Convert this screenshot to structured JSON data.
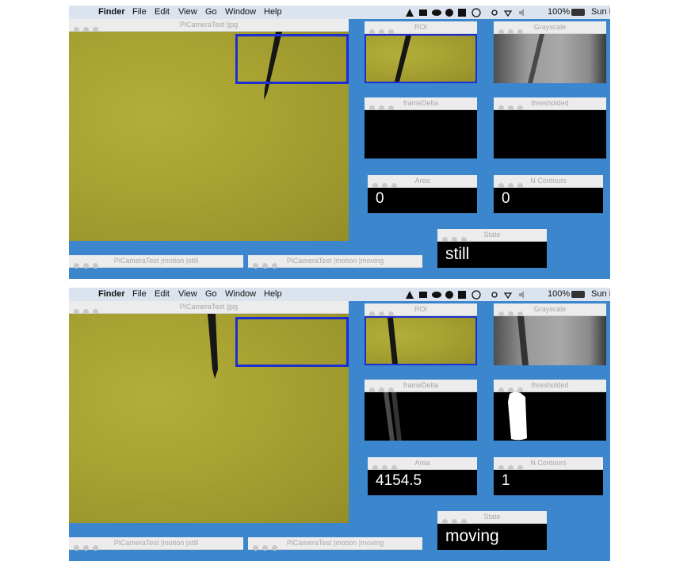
{
  "menubar": {
    "apple": "",
    "items": [
      "Finder",
      "File",
      "Edit",
      "View",
      "Go",
      "Window",
      "Help"
    ],
    "battery": "100%",
    "clock": "Sun N"
  },
  "windows": {
    "main_title": "PiCameraTest  |jpg",
    "roi_title": "ROI",
    "grayscale_title": "Grayscale",
    "framedelta_title": "frameDelta",
    "thresholded_title": "thresholded",
    "area_title": "Area",
    "contours_title": "N Contours",
    "state_title": "State",
    "motion_still_title": "PiCameraTest  |motion |still",
    "motion_moving_title": "PiCameraTest  |motion |moving"
  },
  "frames": [
    {
      "area": "0",
      "contours": "0",
      "state": "still"
    },
    {
      "area": "4154.5",
      "contours": "1",
      "state": "moving"
    }
  ]
}
